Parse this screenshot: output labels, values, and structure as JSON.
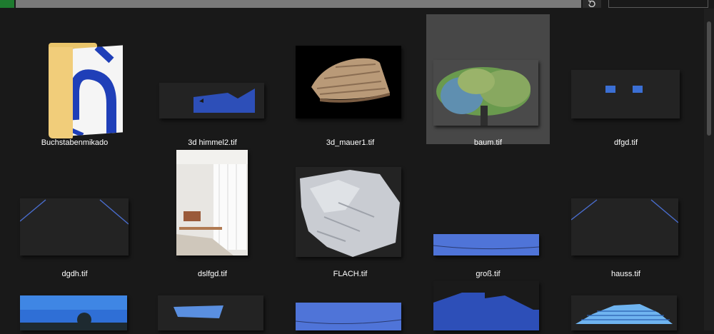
{
  "toolbar": {
    "refresh_icon": "refresh-icon",
    "search_placeholder": ""
  },
  "files": [
    {
      "name": "Buchstabenmikado",
      "type": "folder",
      "icon": "folder-icon"
    },
    {
      "name": "3d himmel2.tif",
      "type": "image"
    },
    {
      "name": "3d_mauer1.tif",
      "type": "image"
    },
    {
      "name": "baum.tif",
      "type": "image",
      "selected": true
    },
    {
      "name": "dfgd.tif",
      "type": "image"
    },
    {
      "name": "dgdh.tif",
      "type": "image"
    },
    {
      "name": "dslfgd.tif",
      "type": "image"
    },
    {
      "name": "FLACH.tif",
      "type": "image"
    },
    {
      "name": "groß.tif",
      "type": "image"
    },
    {
      "name": "hauss.tif",
      "type": "image"
    }
  ],
  "colors": {
    "background": "#191919",
    "selection": "#474747",
    "folder": "#f1cd7a",
    "sky_blue": "#3b6fd4"
  }
}
